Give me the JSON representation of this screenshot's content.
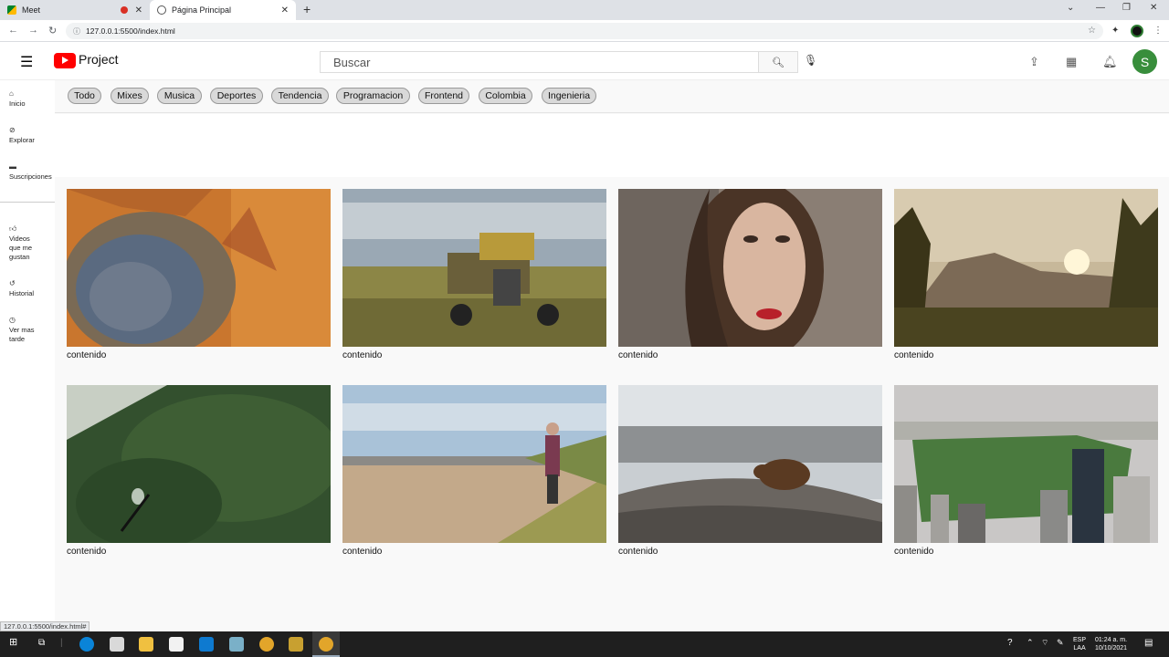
{
  "browser": {
    "tabs": [
      {
        "title": "Meet"
      },
      {
        "title": "Página Principal"
      }
    ],
    "url": "127.0.0.1:5500/index.html",
    "status_url": "127.0.0.1:5500/index.html#"
  },
  "header": {
    "brand": "Project",
    "search_placeholder": "Buscar",
    "avatar_letter": "S"
  },
  "sidebar": {
    "items": [
      {
        "label": "Inicio",
        "icon": "home-icon"
      },
      {
        "label": "Explorar",
        "icon": "compass-icon"
      },
      {
        "label": "Suscripciones",
        "icon": "folder-icon"
      },
      {
        "label": "Videos que me gustan",
        "icon": "thumbs-up-icon"
      },
      {
        "label": "Historial",
        "icon": "history-icon"
      },
      {
        "label": "Ver mas tarde",
        "icon": "clock-icon"
      }
    ]
  },
  "chips": [
    "Todo",
    "Mixes",
    "Musica",
    "Deportes",
    "Tendencia",
    "Programacion",
    "Frontend",
    "Colombia",
    "Ingenieria"
  ],
  "cards": [
    {
      "caption": "contenido"
    },
    {
      "caption": "contenido"
    },
    {
      "caption": "contenido"
    },
    {
      "caption": "contenido"
    },
    {
      "caption": "contenido"
    },
    {
      "caption": "contenido"
    },
    {
      "caption": "contenido"
    },
    {
      "caption": "contenido"
    }
  ],
  "taskbar": {
    "lang": "ESP",
    "lang2": "LAA",
    "time": "01:24 a. m.",
    "date": "10/10/2021"
  }
}
